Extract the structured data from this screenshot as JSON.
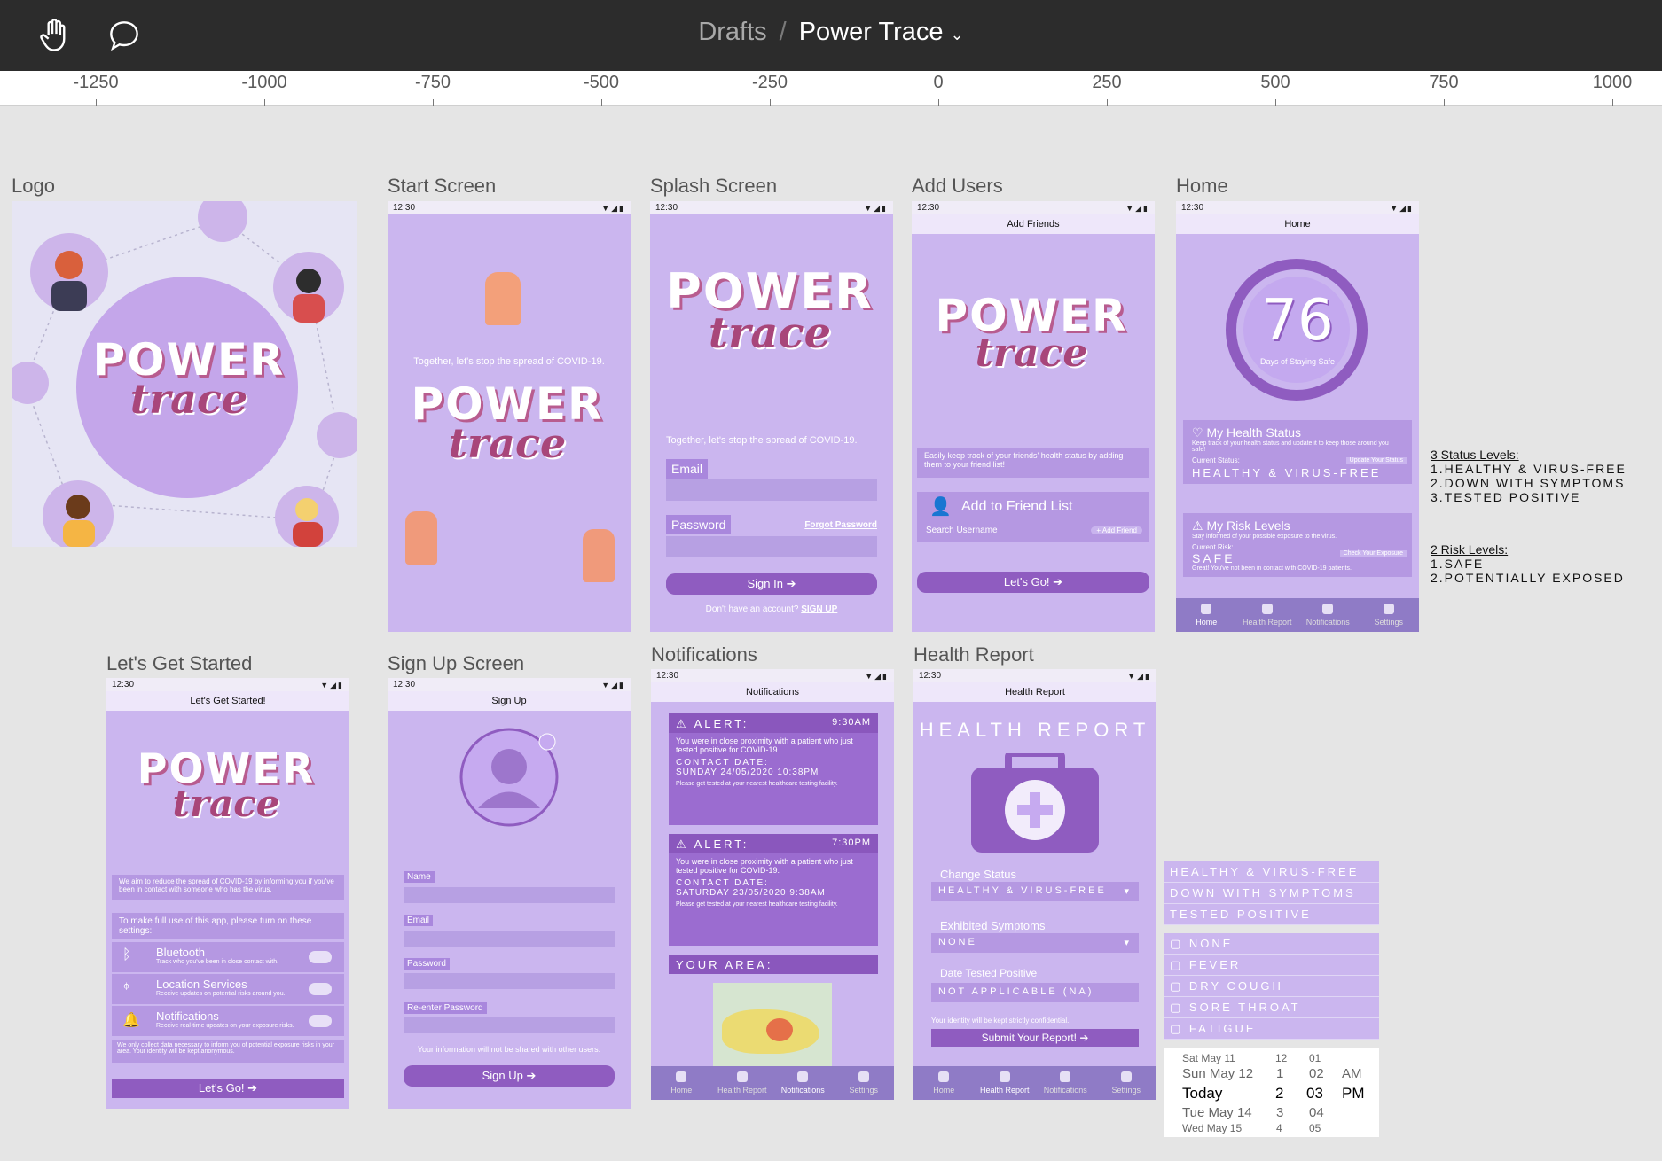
{
  "toolbar": {
    "crumb_parent": "Drafts",
    "separator": "/",
    "crumb_current": "Power Trace",
    "hand_icon": "hand-icon",
    "comment_icon": "comment-icon"
  },
  "ruler": [
    "-1250",
    "-1000",
    "-750",
    "-500",
    "-250",
    "0",
    "250",
    "500",
    "750",
    "1000"
  ],
  "frames": {
    "logo": "Logo",
    "start": "Start Screen",
    "splash": "Splash Screen",
    "add": "Add Users",
    "home": "Home",
    "started": "Let's Get Started",
    "signup": "Sign Up Screen",
    "notif": "Notifications",
    "report": "Health Report"
  },
  "common": {
    "time": "12:30",
    "power": "POWER",
    "trace": "trace",
    "tagline": "Together, let's stop the spread of COVID-19."
  },
  "splash": {
    "email": "Email",
    "password": "Password",
    "forgot": "Forgot Password",
    "signin": "Sign In",
    "noacct": "Don't have an account?",
    "signup": "SIGN UP"
  },
  "add": {
    "header": "Add Friends",
    "desc": "Easily keep track of your friends' health status by adding them to your friend list!",
    "add_list": "Add to Friend List",
    "search": "Search Username",
    "add_btn": "+ Add Friend",
    "go": "Let's Go!"
  },
  "home": {
    "header": "Home",
    "days": "76",
    "days_label": "Days of Staying Safe",
    "status_title": "My Health Status",
    "status_desc": "Keep track of your health status and update it to keep those around you safe!",
    "current_status": "Current Status:",
    "update": "Update Your Status",
    "status_value": "HEALTHY & VIRUS-FREE",
    "risk_title": "My Risk Levels",
    "risk_desc": "Stay informed of your possible exposure to the virus.",
    "current_risk": "Current Risk:",
    "check": "Check Your Exposure",
    "risk_value": "SAFE",
    "risk_note": "Great! You've not been in contact with COVID-19 patients."
  },
  "nav": [
    "Home",
    "Health Report",
    "Notifications",
    "Settings"
  ],
  "status_levels": {
    "title": "3 Status Levels:",
    "items": [
      "1.HEALTHY & VIRUS-FREE",
      "2.DOWN WITH SYMPTOMS",
      "3.TESTED POSITIVE"
    ]
  },
  "risk_levels": {
    "title": "2 Risk Levels:",
    "items": [
      "1.SAFE",
      "2.POTENTIALLY EXPOSED"
    ]
  },
  "started": {
    "header": "Let's Get Started!",
    "aim": "We aim to reduce the spread of COVID-19 by informing you if you've been in contact with someone who has the virus.",
    "make": "To make full use of this app, please turn on these settings:",
    "bt": "Bluetooth",
    "bt_d": "Track who you've been in close contact with.",
    "loc": "Location Services",
    "loc_d": "Receive updates on potential risks around you.",
    "noti": "Notifications",
    "noti_d": "Receive real-time updates on your exposure risks.",
    "only": "We only collect data necessary to inform you of potential exposure risks in your area. Your identity will be kept anonymous.",
    "go": "Let's Go!"
  },
  "signup": {
    "header": "Sign Up",
    "name": "Name",
    "email": "Email",
    "password": "Password",
    "reenter": "Re-enter Password",
    "note": "Your information will not be shared with other users.",
    "btn": "Sign Up"
  },
  "notif": {
    "header": "Notifications",
    "alert": "ALERT:",
    "t1": "9:30AM",
    "t2": "7:30PM",
    "msg": "You were in close proximity with a patient who just tested positive for COVID-19.",
    "contact": "CONTACT DATE:",
    "d1": "SUNDAY 24/05/2020 10:38PM",
    "d2": "SATURDAY 23/05/2020 9:38AM",
    "get": "Please get tested at your nearest healthcare testing facility.",
    "area": "YOUR AREA:"
  },
  "report": {
    "header": "Health Report",
    "title": "HEALTH REPORT",
    "change": "Change Status",
    "status": "HEALTHY & VIRUS-FREE",
    "exhibited": "Exhibited Symptoms",
    "none": "NONE",
    "date": "Date Tested Positive",
    "na": "NOT APPLICABLE (NA)",
    "conf": "Your identity will be kept strictly confidential.",
    "submit": "Submit Your Report!"
  },
  "options_status": [
    "HEALTHY & VIRUS-FREE",
    "DOWN WITH SYMPTOMS",
    "TESTED POSITIVE"
  ],
  "options_symptoms": [
    "NONE",
    "FEVER",
    "DRY COUGH",
    "SORE THROAT",
    "FATIGUE"
  ],
  "picker": {
    "rows": [
      [
        "Sat May 11",
        "12",
        "01",
        ""
      ],
      [
        "Sun May 12",
        "1",
        "02",
        "AM"
      ],
      [
        "Today",
        "2",
        "03",
        "PM"
      ],
      [
        "Tue May 14",
        "3",
        "04",
        ""
      ],
      [
        "Wed May 15",
        "4",
        "05",
        ""
      ]
    ]
  }
}
